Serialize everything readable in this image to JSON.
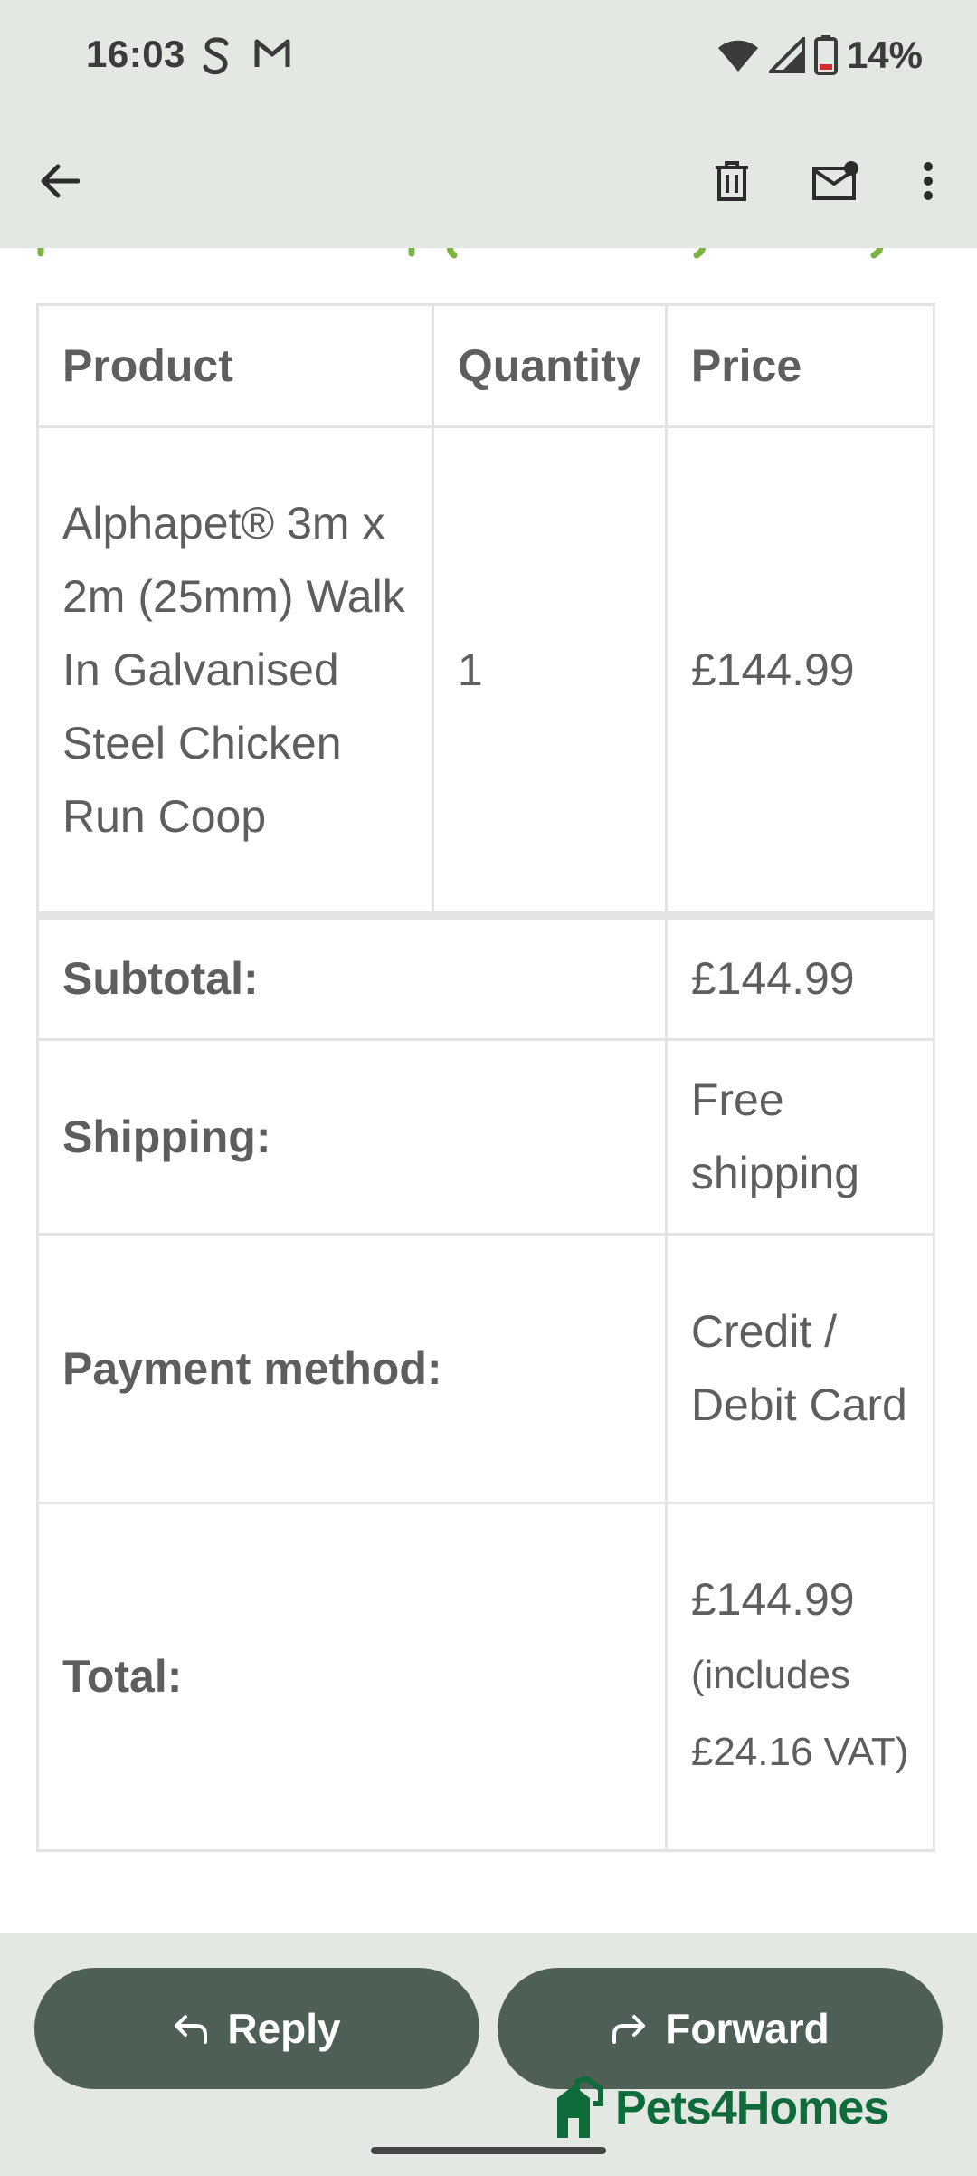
{
  "status_bar": {
    "time": "16:03",
    "battery_text": "14%"
  },
  "table": {
    "headers": [
      "Product",
      "Quantity",
      "Price"
    ],
    "item": {
      "product": "Alphapet® 3m x 2m (25mm) Walk In Galvanised Steel Chicken Run Coop",
      "quantity": "1",
      "price": "£144.99"
    },
    "summary": [
      {
        "label": "Subtotal:",
        "value": "£144.99"
      },
      {
        "label": "Shipping:",
        "value": "Free shipping"
      },
      {
        "label": "Payment method:",
        "value": "Credit / Debit Card"
      },
      {
        "label": "Total:",
        "value": "£144.99",
        "note": "(includes £24.16 VAT)"
      }
    ]
  },
  "actions": {
    "reply_label": "Reply",
    "forward_label": "Forward"
  },
  "watermark": {
    "logo_text": "Pets4Homes"
  },
  "colors": {
    "bar_bg": "#e4e8e2",
    "button_bg": "#4e5f55",
    "accent_green": "#7cb342",
    "logo_green": "#0f6b3a"
  },
  "icons": {
    "back": "arrow-left-icon",
    "delete": "trash-icon",
    "mark_unread": "mail-unread-icon",
    "more": "more-vert-icon",
    "reply": "reply-arrow-icon",
    "forward": "forward-arrow-icon"
  }
}
